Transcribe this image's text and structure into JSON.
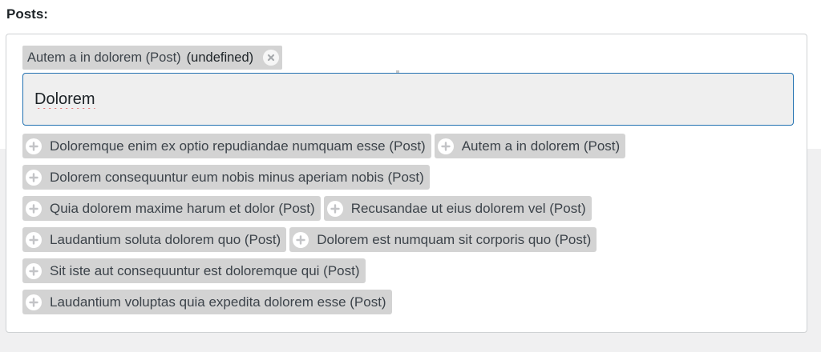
{
  "field": {
    "label": "Posts:"
  },
  "selected": {
    "title": "Autem a in dolorem (Post)",
    "type_tag": "(undefined)",
    "remove_icon": "close-circle-icon"
  },
  "search": {
    "value": "Dolorem"
  },
  "results": [
    [
      "Doloremque enim ex optio repudiandae numquam esse (Post)",
      "Autem a in dolorem (Post)"
    ],
    [
      "Dolorem consequuntur eum nobis minus aperiam nobis (Post)"
    ],
    [
      "Quia dolorem maxime harum et dolor (Post)",
      "Recusandae ut eius dolorem vel (Post)"
    ],
    [
      "Laudantium soluta dolorem quo (Post)",
      "Dolorem est numquam sit corporis quo (Post)"
    ],
    [
      "Sit iste aut consequuntur est doloremque qui (Post)"
    ],
    [
      "Laudantium voluptas quia expedita dolorem esse (Post)"
    ]
  ],
  "result_icon": "plus-circle-icon",
  "colors": {
    "accent": "#2271b1",
    "chip_bg": "#d3d3d3",
    "spellcheck": "#e03b3b"
  }
}
